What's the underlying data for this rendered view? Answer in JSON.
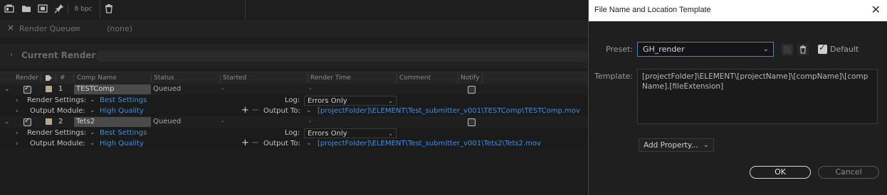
{
  "toolbar": {
    "bpc_label": "8 bpc",
    "icons": [
      "render-queue-icon",
      "folder-icon",
      "composition-icon",
      "pin-icon",
      "trash-icon"
    ]
  },
  "panel": {
    "tab_label": "Render Queue",
    "tab_menu_icon": "≡",
    "none_label": "(none)"
  },
  "current_render": {
    "label": "Current Render"
  },
  "table_headers": {
    "render": "Render",
    "tag_icon": "label-icon",
    "num": "#",
    "comp_name": "Comp Name",
    "status": "Status",
    "started": "Started",
    "render_time": "Render Time",
    "comment": "Comment",
    "notify": "Notify"
  },
  "items": [
    {
      "num": "1",
      "comp_name": "TESTComp",
      "status": "Queued",
      "started": "-",
      "render_time": "-",
      "render_settings_label": "Render Settings:",
      "render_settings_value": "Best Settings",
      "log_label": "Log:",
      "log_value": "Errors Only",
      "output_module_label": "Output Module:",
      "output_module_value": "High Quality",
      "output_to_label": "Output To:",
      "output_path": "[projectFolder]\\ELEMENT\\Test_submitter_v001\\TESTComp\\TESTComp.mov"
    },
    {
      "num": "2",
      "comp_name": "Tets2",
      "status": "Queued",
      "started": "-",
      "render_time": "-",
      "render_settings_label": "Render Settings:",
      "render_settings_value": "Best Settings",
      "log_label": "Log:",
      "log_value": "Errors Only",
      "output_module_label": "Output Module:",
      "output_module_value": "High Quality",
      "output_to_label": "Output To:",
      "output_path": "[projectFolder]\\ELEMENT\\Test_submitter_v001\\Tets2\\Tets2.mov"
    }
  ],
  "dialog": {
    "title": "File Name and Location Template",
    "close_icon": "✕",
    "preset_label": "Preset:",
    "preset_value": "GH_render",
    "default_label": "Default",
    "template_label": "Template:",
    "template_value": "[projectFolder]\\ELEMENT\\[projectName]\\[compName]\\[compName].[fileExtension]",
    "add_property_label": "Add Property...",
    "ok_label": "OK",
    "cancel_label": "Cancel"
  },
  "colors": {
    "link_blue": "#3d8fe0",
    "focus_blue": "#2d8ceb",
    "label_swatch": "#b9a88a"
  }
}
